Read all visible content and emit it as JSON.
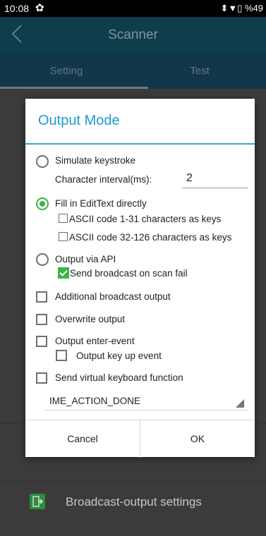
{
  "status_bar": {
    "time": "10:08",
    "settings_icon": "gear-icon",
    "right_text": "⬍▼▯ %49"
  },
  "app_bar": {
    "title": "Scanner",
    "back_icon": "back-chevron-icon"
  },
  "tabs": [
    {
      "label": "Setting"
    },
    {
      "label": "Test"
    }
  ],
  "background_items": [
    {
      "label": "Broadcast-output settings",
      "icon": "export-icon"
    }
  ],
  "dialog": {
    "title": "Output Mode",
    "options": {
      "simulate_keystroke": "Simulate keystroke",
      "character_interval_label": "Character interval(ms):",
      "character_interval_value": "2",
      "fill_edittext": "Fill in EditText directly",
      "ascii_1_31": "ASCII code 1-31 characters as keys",
      "ascii_32_126": "ASCII code 32-126 characters as keys",
      "output_api": "Output via API",
      "send_broadcast_fail": "Send broadcast on scan fail",
      "additional_broadcast": "Additional broadcast output",
      "overwrite_output": "Overwrite output",
      "output_enter_event": "Output enter-event",
      "output_key_up": "Output key up event",
      "send_virtual_keyboard": "Send virtual keyboard function"
    },
    "ime_action_selected": "IME_ACTION_DONE",
    "cancel_label": "Cancel",
    "ok_label": "OK"
  },
  "colors": {
    "accent": "#1e9ad6",
    "checked": "#3cb44a"
  }
}
